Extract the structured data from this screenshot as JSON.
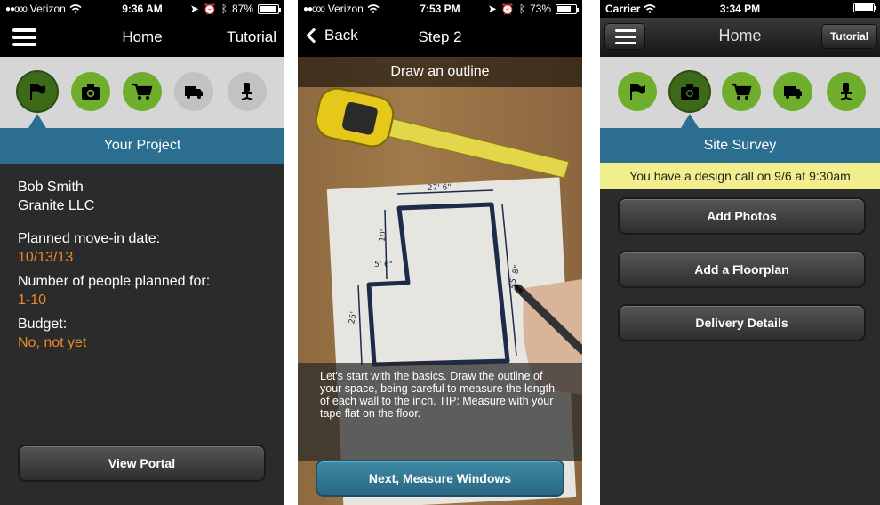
{
  "screen1": {
    "status": {
      "signal": "●●ooo",
      "carrier": "Verizon",
      "time": "9:36 AM",
      "battery": "87%",
      "battery_level": 0.87
    },
    "nav": {
      "title": "Home",
      "right": "Tutorial"
    },
    "section_title": "Your Project",
    "client_name": "Bob Smith",
    "company": "Granite LLC",
    "move_in_label": "Planned move-in date:",
    "move_in_value": "10/13/13",
    "people_label": "Number of people planned for:",
    "people_value": "1-10",
    "budget_label": "Budget:",
    "budget_value": "No, not yet",
    "button": "View Portal"
  },
  "screen2": {
    "status": {
      "signal": "●●ooo",
      "carrier": "Verizon",
      "time": "7:53 PM",
      "battery": "73%",
      "battery_level": 0.73
    },
    "nav": {
      "back": "Back",
      "title": "Step 2"
    },
    "header": "Draw an outline",
    "instructions": "Let's start with the basics. Draw the outline of your space, being careful to measure the length of each wall to the inch. TIP: Measure with your tape flat on the floor.",
    "sketch_labels": {
      "top": "27' 6\"",
      "left_upper": "10'",
      "notch": "5' 6\"",
      "left_lower": "25'",
      "right": "45' 8\""
    },
    "button": "Next, Measure Windows"
  },
  "screen3": {
    "status": {
      "carrier": "Carrier",
      "time": "3:34 PM",
      "battery_level": 1.0
    },
    "nav": {
      "title": "Home",
      "right": "Tutorial"
    },
    "section_title": "Site Survey",
    "notice": "You have a design call on 9/6 at 9:30am",
    "buttons": [
      "Add Photos",
      "Add a Floorplan",
      "Delivery Details"
    ]
  },
  "icons": [
    "flag-icon",
    "camera-icon",
    "cart-icon",
    "truck-icon",
    "chair-icon"
  ],
  "colors": {
    "green": "#6fad2c",
    "teal": "#2c6e8f",
    "orange": "#e8892b",
    "notice": "#f1ee8e"
  }
}
